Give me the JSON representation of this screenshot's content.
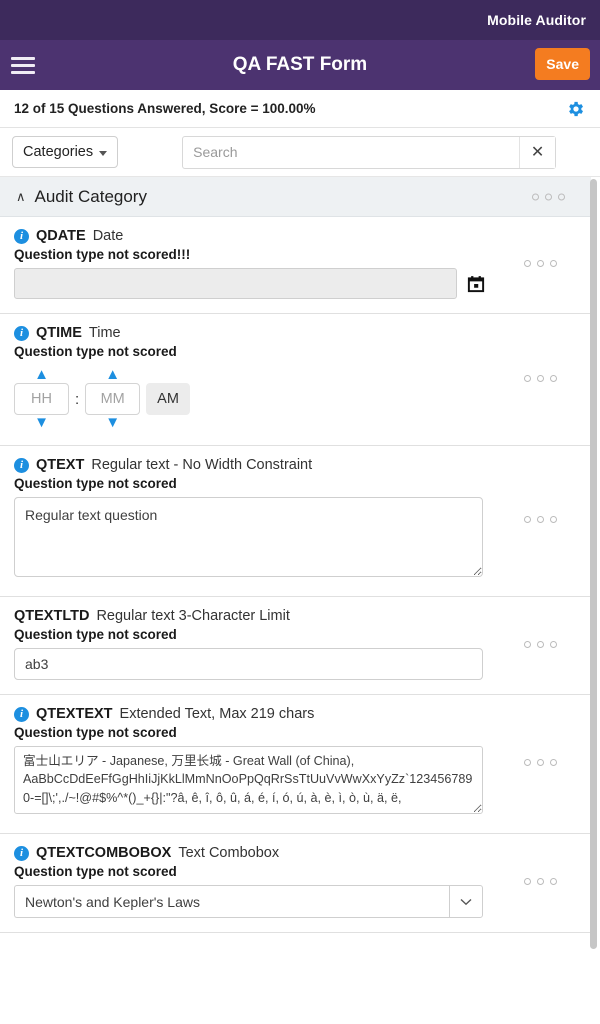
{
  "statusbar": {
    "brand": "Mobile Auditor"
  },
  "appbar": {
    "title": "QA FAST Form",
    "save_label": "Save",
    "menu_icon": "hamburger-icon",
    "bg_color": "#4c3370"
  },
  "scorebar": {
    "text": "12 of 15 Questions Answered, Score = 100.00%",
    "settings_icon": "gear-icon",
    "settings_color": "#1d8fe0"
  },
  "filterbar": {
    "categories_label": "Categories",
    "search_value": "",
    "search_placeholder": "Search",
    "clear_label": "✕"
  },
  "category": {
    "title": "Audit Category",
    "collapse_caret": "∧",
    "overflow_icon": "three-dots-icon"
  },
  "questions": [
    {
      "has_info": true,
      "code": "QDATE",
      "name": "Date",
      "scored_text": "Question type not scored!!!",
      "type": "date",
      "value": "",
      "placeholder": "",
      "picker_icon": "calendar-icon"
    },
    {
      "has_info": true,
      "code": "QTIME",
      "name": "Time",
      "scored_text": "Question type not scored",
      "type": "time",
      "hour_value": "",
      "hour_placeholder": "HH",
      "minute_value": "",
      "minute_placeholder": "MM",
      "separator": ":",
      "meridiem": "AM",
      "up_arrow": "▲",
      "down_arrow": "▼"
    },
    {
      "has_info": true,
      "code": "QTEXT",
      "name": "Regular text - No Width Constraint",
      "scored_text": "Question type not scored",
      "type": "textarea",
      "value": "Regular text question",
      "placeholder": ""
    },
    {
      "has_info": false,
      "code": "QTEXTLTD",
      "name": "Regular text 3-Character Limit",
      "scored_text": "Question type not scored",
      "type": "text",
      "value": "ab3",
      "placeholder": ""
    },
    {
      "has_info": true,
      "code": "QTEXTEXT",
      "name": "Extended Text, Max 219 chars",
      "scored_text": "Question type not scored",
      "type": "textarea-ext",
      "value": "富士山エリア - Japanese, 万里长城 - Great Wall (of China), AaBbCcDdEeFfGgHhIiJjKkLlMmNnOoPpQqRrSsTtUuVvWwXxYyZz`1234567890-=[]\\;',./~!@#$%^*()_+{}|:\"?â, ê, î, ô, û, á, é, í, ó, ú, à, è, ì, ò, ù, ä, ë,",
      "placeholder": ""
    },
    {
      "has_info": true,
      "code": "QTEXTCOMBOBOX",
      "name": "Text Combobox",
      "scored_text": "Question type not scored",
      "type": "combobox",
      "value": "Newton's and Kepler's Laws",
      "placeholder": "",
      "dropdown_icon": "chevron-down-icon"
    }
  ]
}
